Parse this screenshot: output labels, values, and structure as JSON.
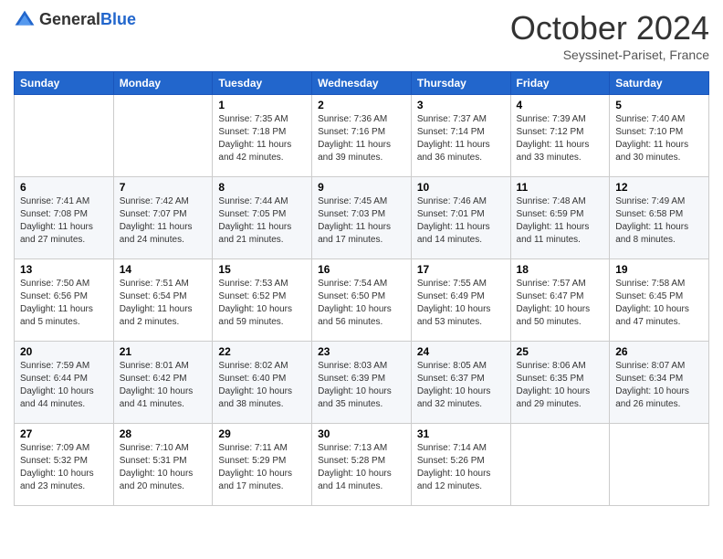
{
  "header": {
    "logo_general": "General",
    "logo_blue": "Blue",
    "title": "October 2024",
    "location": "Seyssinet-Pariset, France"
  },
  "days_of_week": [
    "Sunday",
    "Monday",
    "Tuesday",
    "Wednesday",
    "Thursday",
    "Friday",
    "Saturday"
  ],
  "weeks": [
    [
      {
        "day": "",
        "sunrise": "",
        "sunset": "",
        "daylight": ""
      },
      {
        "day": "",
        "sunrise": "",
        "sunset": "",
        "daylight": ""
      },
      {
        "day": "1",
        "sunrise": "Sunrise: 7:35 AM",
        "sunset": "Sunset: 7:18 PM",
        "daylight": "Daylight: 11 hours and 42 minutes."
      },
      {
        "day": "2",
        "sunrise": "Sunrise: 7:36 AM",
        "sunset": "Sunset: 7:16 PM",
        "daylight": "Daylight: 11 hours and 39 minutes."
      },
      {
        "day": "3",
        "sunrise": "Sunrise: 7:37 AM",
        "sunset": "Sunset: 7:14 PM",
        "daylight": "Daylight: 11 hours and 36 minutes."
      },
      {
        "day": "4",
        "sunrise": "Sunrise: 7:39 AM",
        "sunset": "Sunset: 7:12 PM",
        "daylight": "Daylight: 11 hours and 33 minutes."
      },
      {
        "day": "5",
        "sunrise": "Sunrise: 7:40 AM",
        "sunset": "Sunset: 7:10 PM",
        "daylight": "Daylight: 11 hours and 30 minutes."
      }
    ],
    [
      {
        "day": "6",
        "sunrise": "Sunrise: 7:41 AM",
        "sunset": "Sunset: 7:08 PM",
        "daylight": "Daylight: 11 hours and 27 minutes."
      },
      {
        "day": "7",
        "sunrise": "Sunrise: 7:42 AM",
        "sunset": "Sunset: 7:07 PM",
        "daylight": "Daylight: 11 hours and 24 minutes."
      },
      {
        "day": "8",
        "sunrise": "Sunrise: 7:44 AM",
        "sunset": "Sunset: 7:05 PM",
        "daylight": "Daylight: 11 hours and 21 minutes."
      },
      {
        "day": "9",
        "sunrise": "Sunrise: 7:45 AM",
        "sunset": "Sunset: 7:03 PM",
        "daylight": "Daylight: 11 hours and 17 minutes."
      },
      {
        "day": "10",
        "sunrise": "Sunrise: 7:46 AM",
        "sunset": "Sunset: 7:01 PM",
        "daylight": "Daylight: 11 hours and 14 minutes."
      },
      {
        "day": "11",
        "sunrise": "Sunrise: 7:48 AM",
        "sunset": "Sunset: 6:59 PM",
        "daylight": "Daylight: 11 hours and 11 minutes."
      },
      {
        "day": "12",
        "sunrise": "Sunrise: 7:49 AM",
        "sunset": "Sunset: 6:58 PM",
        "daylight": "Daylight: 11 hours and 8 minutes."
      }
    ],
    [
      {
        "day": "13",
        "sunrise": "Sunrise: 7:50 AM",
        "sunset": "Sunset: 6:56 PM",
        "daylight": "Daylight: 11 hours and 5 minutes."
      },
      {
        "day": "14",
        "sunrise": "Sunrise: 7:51 AM",
        "sunset": "Sunset: 6:54 PM",
        "daylight": "Daylight: 11 hours and 2 minutes."
      },
      {
        "day": "15",
        "sunrise": "Sunrise: 7:53 AM",
        "sunset": "Sunset: 6:52 PM",
        "daylight": "Daylight: 10 hours and 59 minutes."
      },
      {
        "day": "16",
        "sunrise": "Sunrise: 7:54 AM",
        "sunset": "Sunset: 6:50 PM",
        "daylight": "Daylight: 10 hours and 56 minutes."
      },
      {
        "day": "17",
        "sunrise": "Sunrise: 7:55 AM",
        "sunset": "Sunset: 6:49 PM",
        "daylight": "Daylight: 10 hours and 53 minutes."
      },
      {
        "day": "18",
        "sunrise": "Sunrise: 7:57 AM",
        "sunset": "Sunset: 6:47 PM",
        "daylight": "Daylight: 10 hours and 50 minutes."
      },
      {
        "day": "19",
        "sunrise": "Sunrise: 7:58 AM",
        "sunset": "Sunset: 6:45 PM",
        "daylight": "Daylight: 10 hours and 47 minutes."
      }
    ],
    [
      {
        "day": "20",
        "sunrise": "Sunrise: 7:59 AM",
        "sunset": "Sunset: 6:44 PM",
        "daylight": "Daylight: 10 hours and 44 minutes."
      },
      {
        "day": "21",
        "sunrise": "Sunrise: 8:01 AM",
        "sunset": "Sunset: 6:42 PM",
        "daylight": "Daylight: 10 hours and 41 minutes."
      },
      {
        "day": "22",
        "sunrise": "Sunrise: 8:02 AM",
        "sunset": "Sunset: 6:40 PM",
        "daylight": "Daylight: 10 hours and 38 minutes."
      },
      {
        "day": "23",
        "sunrise": "Sunrise: 8:03 AM",
        "sunset": "Sunset: 6:39 PM",
        "daylight": "Daylight: 10 hours and 35 minutes."
      },
      {
        "day": "24",
        "sunrise": "Sunrise: 8:05 AM",
        "sunset": "Sunset: 6:37 PM",
        "daylight": "Daylight: 10 hours and 32 minutes."
      },
      {
        "day": "25",
        "sunrise": "Sunrise: 8:06 AM",
        "sunset": "Sunset: 6:35 PM",
        "daylight": "Daylight: 10 hours and 29 minutes."
      },
      {
        "day": "26",
        "sunrise": "Sunrise: 8:07 AM",
        "sunset": "Sunset: 6:34 PM",
        "daylight": "Daylight: 10 hours and 26 minutes."
      }
    ],
    [
      {
        "day": "27",
        "sunrise": "Sunrise: 7:09 AM",
        "sunset": "Sunset: 5:32 PM",
        "daylight": "Daylight: 10 hours and 23 minutes."
      },
      {
        "day": "28",
        "sunrise": "Sunrise: 7:10 AM",
        "sunset": "Sunset: 5:31 PM",
        "daylight": "Daylight: 10 hours and 20 minutes."
      },
      {
        "day": "29",
        "sunrise": "Sunrise: 7:11 AM",
        "sunset": "Sunset: 5:29 PM",
        "daylight": "Daylight: 10 hours and 17 minutes."
      },
      {
        "day": "30",
        "sunrise": "Sunrise: 7:13 AM",
        "sunset": "Sunset: 5:28 PM",
        "daylight": "Daylight: 10 hours and 14 minutes."
      },
      {
        "day": "31",
        "sunrise": "Sunrise: 7:14 AM",
        "sunset": "Sunset: 5:26 PM",
        "daylight": "Daylight: 10 hours and 12 minutes."
      },
      {
        "day": "",
        "sunrise": "",
        "sunset": "",
        "daylight": ""
      },
      {
        "day": "",
        "sunrise": "",
        "sunset": "",
        "daylight": ""
      }
    ]
  ]
}
